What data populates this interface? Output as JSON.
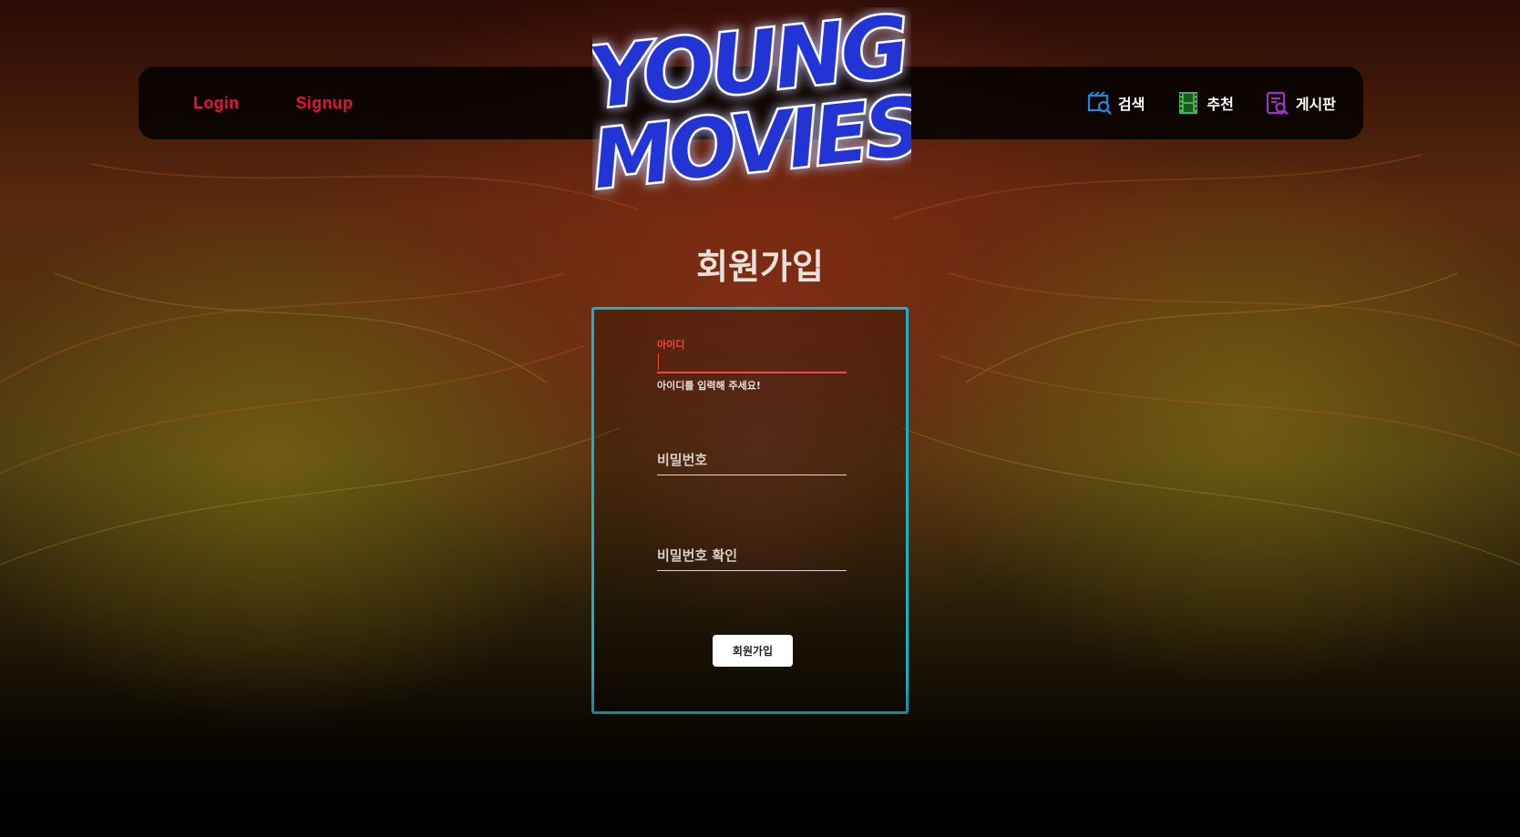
{
  "nav": {
    "login": "Login",
    "signup": "Signup",
    "search": "검색",
    "recommend": "추천",
    "board": "게시판"
  },
  "logo": {
    "line1": "YOUNG",
    "line2": "MOVIES"
  },
  "page": {
    "title": "회원가입"
  },
  "form": {
    "id_label": "아이디",
    "id_value": "",
    "id_helper": "아이디를 입력해 주세요!",
    "password_placeholder": "비밀번호",
    "password_confirm_placeholder": "비밀번호 확인",
    "submit_label": "회원가입"
  },
  "colors": {
    "nav_link": "#e8123c",
    "form_border": "#1ab0c6",
    "error": "#ef4b3f",
    "logo_fill": "#2236d4",
    "search_icon": "#1e88e5",
    "recommend_icon": "#43b049",
    "board_icon": "#a033c7"
  },
  "icons": {
    "search": "search-film-icon",
    "recommend": "film-strip-icon",
    "board": "board-search-icon"
  }
}
